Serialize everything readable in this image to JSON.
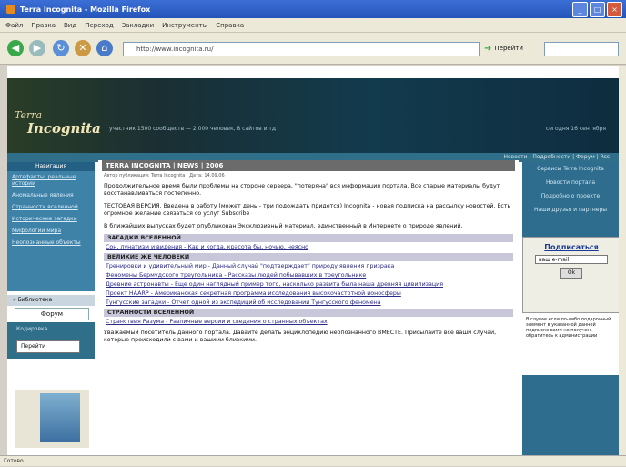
{
  "window": {
    "title": "Terra Incognita - Mozilla Firefox"
  },
  "menu": [
    "Файл",
    "Правка",
    "Вид",
    "Переход",
    "Закладки",
    "Инструменты",
    "Справка"
  ],
  "toolbar": {
    "url": "http://www.incognita.ru/",
    "go_label": "Перейти",
    "back_icon": "back-arrow-icon",
    "forward_icon": "forward-arrow-icon"
  },
  "banner": {
    "logo_top": "Terra",
    "logo_bottom": "Incognita",
    "tagline": "участник 1500 сообществ — 2 000 человек, 8 сайтов и тд",
    "date": "сегодня 16 сентября"
  },
  "subbar": {
    "text": "Новости | Подробности | Форум | Rss"
  },
  "leftnav": {
    "head": "Навигация",
    "items": [
      "Артефакты, реальные истории",
      "Аномальные явления",
      "Странности вселенной",
      "Исторические загадки",
      "Мифологии мира",
      "Неопознанные объекты"
    ]
  },
  "library": "» Библиотека",
  "forum": "Форум",
  "encoding": {
    "label": "Кодировка",
    "value": "Перейти"
  },
  "article": {
    "title": "TERRA INCOGNITA | NEWS | 2006",
    "meta": "Автор публикации: Terra Incognita | Дата: 14.09.06",
    "p1": "Продолжительное время были проблемы на стороне сервера, \"потеряна\" вся информация портала. Все старые материалы будут восстанавливаться постепенно.",
    "p2": "ТЕСТОВАЯ ВЕРСИЯ. Введена в работу (может день - три подождать придется) Incognita - новая подписка на рассылку новостей. Есть огромное желание связаться со услуг Subscribe",
    "p3": "В ближайших выпусках будет опубликован Эксклюзивный материал, единственный в Интернете о природе явлений.",
    "section1": "ЗАГАДКИ ВСЕЛЕННОЙ",
    "item1": "Сон, лунатизм и видения - Как и когда, красота бы, ночью, неясно",
    "section2": "ВЕЛИКИЕ ЖЕ ЧЕЛОВЕКИ",
    "item2": "Тренировки и удивительный мир - Данный случай \"подтверждает\" природу явления призрака",
    "item3": "Феномены Бермудского треугольника - Рассказы людей побывавших в треугольнике",
    "item4": "Древние астронавты - Еще один наглядный пример того, насколько развита была наша древняя цивилизация",
    "item5": "Проект HAARP - Американская секретная программа исследования высокочастотной ионосферы",
    "item6": "Тунгусские загадки - Отчет одной из экспедиций об исследовании Тунгусского феномена",
    "section3": "СТРАННОСТИ ВСЕЛЕННОЙ",
    "item7": "Странствия Разума - Различные версии и сведения о странных объектах",
    "footer": "Уважаемый посетитель данного портала. Давайте делать энциклопедию неопознанного ВМЕСТЕ. Присылайте все ваши случаи, которые происходили с вами и вашими близкими."
  },
  "rightcol": {
    "links": [
      "Сервисы Terra Incognita",
      "Новости портала",
      "Подробно о проекте",
      "Наши друзья и партнеры"
    ]
  },
  "subscribe": {
    "title": "Подписаться",
    "email_placeholder": "ваш e-mail",
    "ok_label": "Ok"
  },
  "notice": "В случае если по-либо подарочный элемент в указанной данной подписке вами не получен, обратитесь к администрации",
  "status": "Готово"
}
